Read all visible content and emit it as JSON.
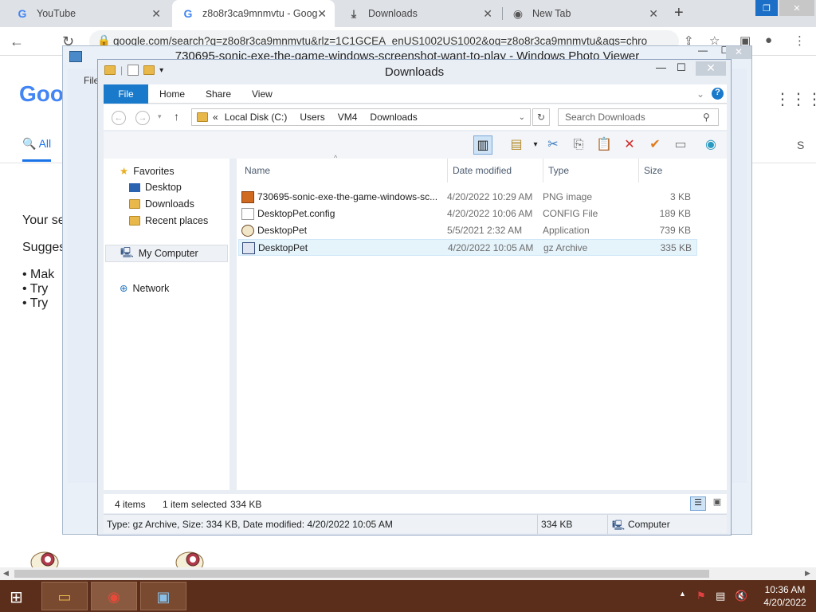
{
  "chrome": {
    "tabs": [
      {
        "title": "YouTube",
        "icon": "google-icon"
      },
      {
        "title": "z8o8r3ca9mnmvtu - Goog",
        "icon": "google-icon"
      },
      {
        "title": "Downloads",
        "icon": "download-icon"
      },
      {
        "title": "New Tab",
        "icon": "chrome-icon"
      }
    ],
    "url": "google.com/search?q=z8o8r3ca9mnmvtu&rlz=1C1GCEA_enUS1002US1002&oq=z8o8r3ca9mnmvtu&aqs=chro",
    "new_tab": "+"
  },
  "google": {
    "logo": "Goo",
    "tab_all": "All",
    "right_s": "S",
    "your_search": "Your se",
    "suggestions": "Sugges",
    "bullets": [
      "Mak",
      "Try",
      "Try"
    ]
  },
  "photo_viewer": {
    "title": "730695-sonic-exe-the-game-windows-screenshot-want-to-play - Windows Photo Viewer",
    "file_menu": "File"
  },
  "explorer": {
    "title": "Downloads",
    "ribbon_tabs": [
      "File",
      "Home",
      "Share",
      "View"
    ],
    "breadcrumb": [
      "«",
      "Local Disk (C:)",
      "Users",
      "VM4",
      "Downloads"
    ],
    "search_placeholder": "Search Downloads",
    "nav": {
      "favorites": "Favorites",
      "desktop": "Desktop",
      "downloads": "Downloads",
      "recent": "Recent places",
      "computer": "My Computer",
      "network": "Network"
    },
    "columns": {
      "name": "Name",
      "date": "Date modified",
      "type": "Type",
      "size": "Size"
    },
    "files": [
      {
        "name": "730695-sonic-exe-the-game-windows-sc...",
        "date": "4/20/2022 10:29 AM",
        "type": "PNG image",
        "size": "3 KB",
        "icon": "image-file-icon"
      },
      {
        "name": "DesktopPet.config",
        "date": "4/20/2022 10:06 AM",
        "type": "CONFIG File",
        "size": "189 KB",
        "icon": "config-file-icon"
      },
      {
        "name": "DesktopPet",
        "date": "5/5/2021 2:32 AM",
        "type": "Application",
        "size": "739 KB",
        "icon": "sheep-app-icon"
      },
      {
        "name": "DesktopPet",
        "date": "4/20/2022 10:05 AM",
        "type": "gz Archive",
        "size": "335 KB",
        "icon": "archive-file-icon",
        "selected": true
      }
    ],
    "status": {
      "items": "4 items",
      "selected": "1 item selected",
      "selected_size": "334 KB"
    },
    "details": {
      "text": "Type: gz Archive, Size: 334 KB, Date modified: 4/20/2022 10:05 AM",
      "size": "334 KB",
      "location": "Computer"
    }
  },
  "taskbar": {
    "time": "10:36 AM",
    "date": "4/20/2022",
    "color": "#5a2e1a"
  }
}
